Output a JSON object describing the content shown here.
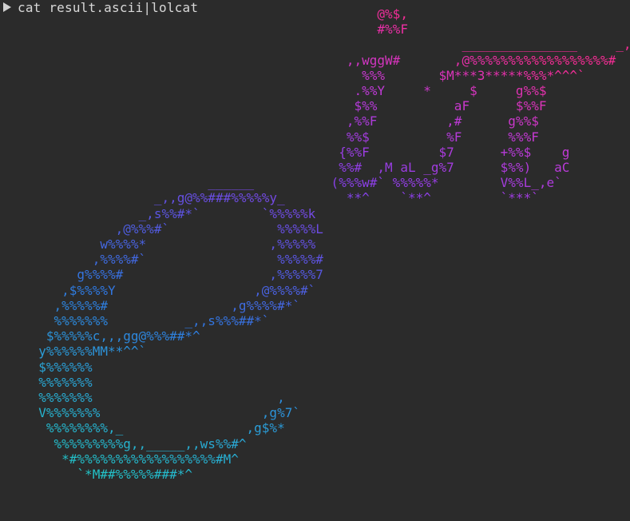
{
  "terminal": {
    "command": "cat result.ascii|lolcat",
    "prompt_icon": "triangle-right-icon"
  },
  "ascii_art": {
    "lines": [
      "                                                 @%$,",
      "                                                 #%%F",
      "                                                            _______________     _,",
      "                                             ,,wggW#       ,@%%%%%%%%%%%%%%%%%%#",
      "                                               %%%       $M***3*****%%%*^^^`",
      "                                              .%%Y     *     $     g%%$",
      "                                              $%%          aF      $%%F",
      "                                             ,%%F         ,#      g%%$",
      "                                             %%$          %F      %%%F",
      "                                            {%%F         $7      +%%$    g",
      "                                            %%#  ,M aL _g%7      $%%)   aC",
      "                           ______          (%%%w#` %%%%%*        V%%L_,e`",
      "                    _,,g@%%###%%%%%y_        **^    `**^         `***`",
      "                  _,s%%#*`        `%%%%%k",
      "               ,@%%%#`              %%%%%L",
      "             w%%%%*                ,%%%%%",
      "            ,%%%%#`                 %%%%%#",
      "          g%%%%#                   ,%%%%%7",
      "        ,$%%%%Y                  ,@%%%%#`",
      "       ,%%%%%#                ,g%%%%#*`",
      "       %%%%%%%          _,,s%%%##*`",
      "      $%%%%%c,,,gg@%%%##*^",
      "     y%%%%%%MM**^^`",
      "     $%%%%%%",
      "     %%%%%%%",
      "     %%%%%%%                        ,",
      "     V%%%%%%%                     ,g%7`",
      "      %%%%%%%%,_                ,g$%*",
      "       %%%%%%%%%g,,_____,,ws%%#^",
      "        *#%%%%%%%%%%%%%%%%%%#M^",
      "          `*M##%%%%%###*^"
    ]
  },
  "colors": {
    "background": "#2b2b2b",
    "prompt_text": "#d8d8d8",
    "rainbow_stops": [
      "#ff2a8a",
      "#c13ad6",
      "#8a3fe6",
      "#5a55e0",
      "#2f78df",
      "#2aa6d6",
      "#21c7c4",
      "#3fdc9d"
    ]
  }
}
